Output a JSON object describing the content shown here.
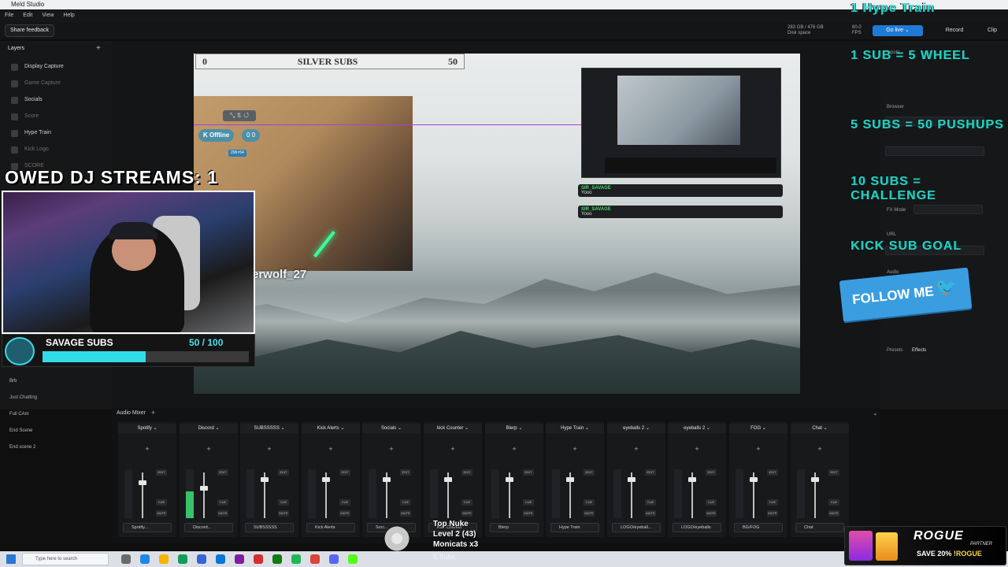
{
  "app": {
    "title": "Meld Studio",
    "menu": [
      "File",
      "Edit",
      "View",
      "Help"
    ]
  },
  "toolbar": {
    "feedback": "Share feedback",
    "disk": "283 GB / 476 GB",
    "disk_label": "Disk space",
    "fps_value": "60.0",
    "fps_label": "FPS",
    "golive": "Go live ⌄",
    "record": "Record",
    "clip": "Clip"
  },
  "layers": {
    "title": "Layers",
    "add": "+",
    "items": [
      {
        "label": "Display Capture",
        "dim": false
      },
      {
        "label": "Game Capture",
        "dim": true
      },
      {
        "label": "Socials",
        "dim": false
      },
      {
        "label": "Score",
        "dim": true
      },
      {
        "label": "Hype Train",
        "dim": false
      },
      {
        "label": "Kick Logo",
        "dim": true
      },
      {
        "label": "SCORE",
        "dim": true
      }
    ],
    "scenes": [
      "Brb",
      "Just Chatting",
      "Full CAm",
      "End Scene",
      "End scene 2"
    ]
  },
  "preview": {
    "silver_left": "0",
    "silver_title": "SILVER SUBS",
    "silver_right": "50",
    "offline": "Offline",
    "counts": "0  0",
    "size_tag": "296×54",
    "wolf_name": "erwolf_27",
    "chat": [
      {
        "user": "SIR_SAVAGE",
        "msg": "Yooo"
      },
      {
        "user": "SIR_SAVAGE",
        "msg": "Yooo"
      }
    ]
  },
  "overlay": {
    "dj_streams": "OWED DJ STREAMS: 1",
    "subs_title": "SAVAGE SUBS",
    "subs_count": "50  /  100",
    "subs_progress": 0.5,
    "follow": "FOLLOW ME",
    "follow_icon": "twitter-bird-icon"
  },
  "props": {
    "labels": [
      "Inputs",
      "Browser",
      "FX Mode",
      "URL",
      "Audio",
      "Presets",
      "Effects"
    ],
    "glitch": [
      "1 Hype Train",
      "1 SUB = 5 WHEEL",
      "5 SUBS = 50 PUSHUPS",
      "10 SUBS = CHALLENGE",
      "KICK SUB GOAL"
    ]
  },
  "mixer": {
    "title": "Audio Mixer",
    "add": "+",
    "strips": [
      {
        "name": "Spotify",
        "foot": "Spotify...",
        "level": 0.0,
        "fader": 0.82
      },
      {
        "name": "Discord",
        "foot": "Discord...",
        "level": 0.55,
        "fader": 0.7
      },
      {
        "name": "SUBSSSSS",
        "foot": "SUBSSSSS",
        "level": 0.0,
        "fader": 0.9
      },
      {
        "name": "Kick Alerts",
        "foot": "Kick Alerts",
        "level": 0.0,
        "fader": 0.9
      },
      {
        "name": "Socials",
        "foot": "Soci...",
        "level": 0.0,
        "fader": 0.9
      },
      {
        "name": "kick Counter",
        "foot": "Kick Counter",
        "level": 0.0,
        "fader": 0.9
      },
      {
        "name": "Blerp",
        "foot": "Blerp",
        "level": 0.0,
        "fader": 0.9
      },
      {
        "name": "Hype Train",
        "foot": "Hype Train",
        "level": 0.0,
        "fader": 0.9
      },
      {
        "name": "eyeballs 2",
        "foot": "LOGO/eyeball...",
        "level": 0.0,
        "fader": 0.9
      },
      {
        "name": "eyeballs 2",
        "foot": "LOGO/eyeballs",
        "level": 0.0,
        "fader": 0.9
      },
      {
        "name": "FOG",
        "foot": "BG/FOG",
        "level": 0.0,
        "fader": 0.9
      },
      {
        "name": "Chat",
        "foot": "Chat",
        "level": 0.0,
        "fader": 0.9
      }
    ],
    "btn_edit": "EDIT",
    "btn_cue": "CUE",
    "btn_mute": "MUTE"
  },
  "nuke": {
    "line1": "Top Nuke",
    "line2": "Level 2  (43)",
    "line3": "Monicats x3",
    "subs": "5 Subs"
  },
  "taskbar": {
    "search": "Type here to search"
  },
  "rogue": {
    "logo": "ROGUE",
    "partner": "PARTNER",
    "save": "SAVE 20%",
    "code": "!ROGUE"
  },
  "colors": {
    "accent": "#1f7ad6",
    "subs": "#32dbe8",
    "glitch": "#2be0cf",
    "twitter": "#3a9de0"
  }
}
